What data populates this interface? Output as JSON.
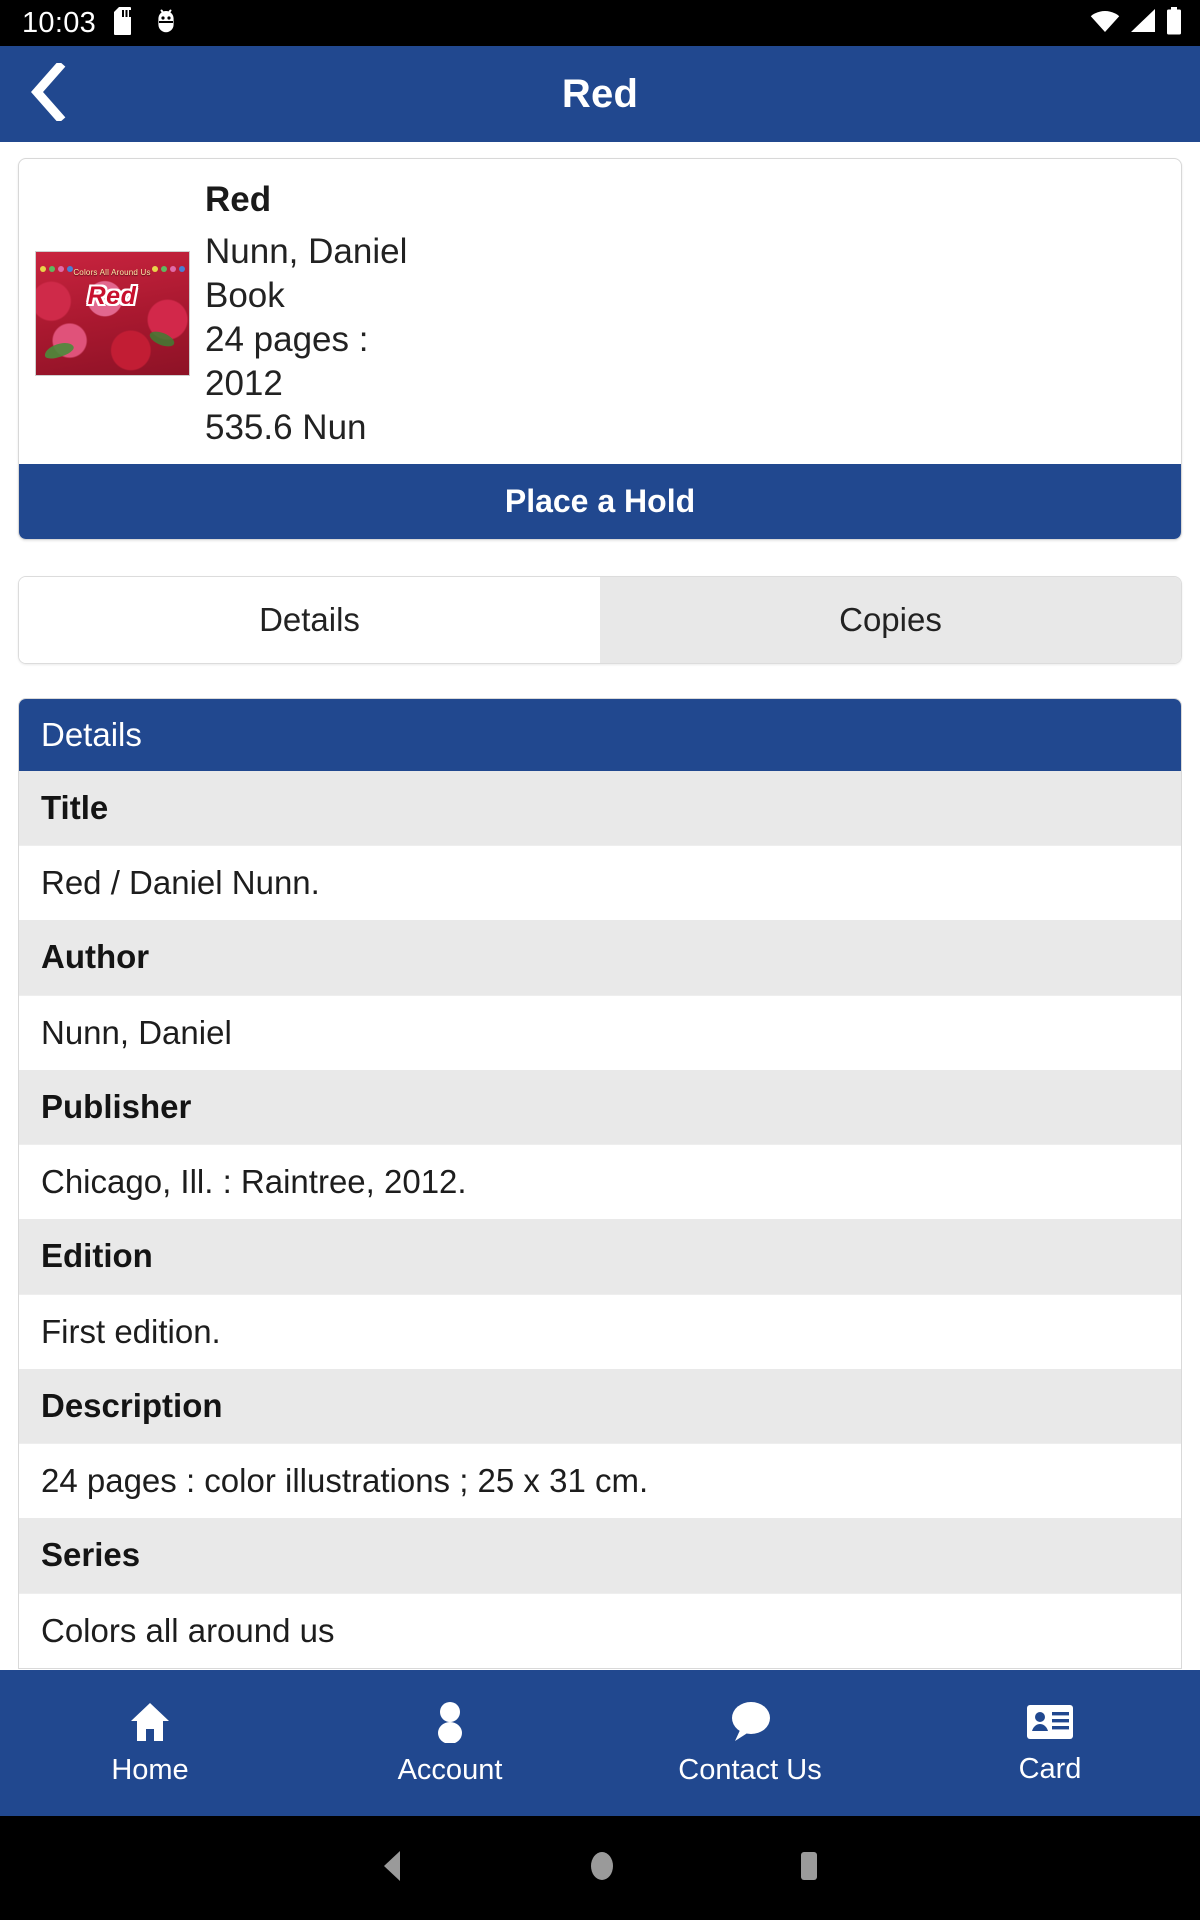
{
  "status_bar": {
    "time": "10:03",
    "left_icons": [
      "sd-card-icon",
      "android-debug-icon"
    ],
    "right_icons": [
      "wifi-icon",
      "cellular-signal-icon",
      "battery-icon"
    ]
  },
  "header": {
    "back_icon": "chevron-left-icon",
    "title": "Red"
  },
  "book": {
    "cover": {
      "series_text": "Colors All Around Us",
      "title_text": "Red",
      "alt": "strawberries-cover-image"
    },
    "title": "Red",
    "lines": [
      "Nunn, Daniel",
      "Book",
      "24 pages :",
      "2012",
      "535.6 Nun"
    ],
    "hold_button": "Place a Hold"
  },
  "tabs": [
    {
      "label": "Details",
      "active": true
    },
    {
      "label": "Copies",
      "active": false
    }
  ],
  "details_panel": {
    "heading": "Details",
    "rows": [
      {
        "label": "Title",
        "value": "Red / Daniel Nunn."
      },
      {
        "label": "Author",
        "value": "Nunn, Daniel"
      },
      {
        "label": "Publisher",
        "value": "Chicago, Ill. : Raintree, 2012."
      },
      {
        "label": "Edition",
        "value": "First edition."
      },
      {
        "label": "Description",
        "value": "24 pages : color illustrations ; 25 x 31 cm."
      },
      {
        "label": "Series",
        "value": "Colors all around us"
      }
    ]
  },
  "bottom_nav": [
    {
      "label": "Home",
      "icon": "home-icon"
    },
    {
      "label": "Account",
      "icon": "person-icon"
    },
    {
      "label": "Contact Us",
      "icon": "speech-bubble-icon"
    },
    {
      "label": "Card",
      "icon": "id-card-icon"
    }
  ],
  "system_nav": {
    "back": "triangle-back-icon",
    "home": "circle-home-icon",
    "recents": "square-recents-icon"
  },
  "colors": {
    "brand_blue": "#21488f",
    "status_bar_bg": "#000000",
    "row_label_bg": "#e9e9e9",
    "tab_inactive_bg": "#e8e8e8"
  }
}
